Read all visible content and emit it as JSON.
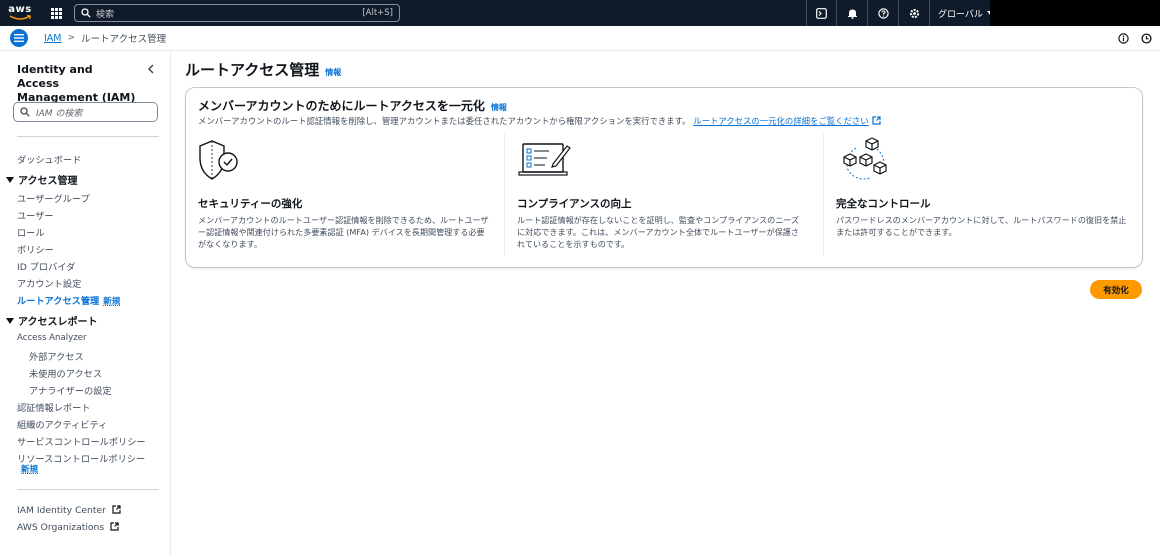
{
  "topbar": {
    "logo_text": "aws",
    "search_placeholder": "検索",
    "search_shortcut": "[Alt+S]",
    "region": "グローバル"
  },
  "breadcrumb": {
    "root": "IAM",
    "current": "ルートアクセス管理"
  },
  "sidebar": {
    "title": "Identity and Access Management (IAM)",
    "search_placeholder": "IAM の検索",
    "dashboard": "ダッシュボード",
    "access_mgmt_heading": "アクセス管理",
    "access_mgmt_items": [
      "ユーザーグループ",
      "ユーザー",
      "ロール",
      "ポリシー",
      "ID プロバイダ",
      "アカウント設定"
    ],
    "root_access": "ルートアクセス管理",
    "new_badge": "新規",
    "access_reports_heading": "アクセスレポート",
    "access_analyzer": "Access Analyzer",
    "analyzer_items": [
      "外部アクセス",
      "未使用のアクセス",
      "アナライザーの設定"
    ],
    "report_items": [
      "認証情報レポート",
      "組織のアクティビティ",
      "サービスコントロールポリシー"
    ],
    "resource_policy": "リソースコントロールポリシー",
    "resource_policy_badge": "新規",
    "external_links": [
      "IAM Identity Center",
      "AWS Organizations"
    ]
  },
  "main": {
    "title": "ルートアクセス管理",
    "info": "情報",
    "card": {
      "title": "メンバーアカウントのためにルートアクセスを一元化",
      "info": "情報",
      "description": "メンバーアカウントのルート認証情報を削除し、管理アカウントまたは委任されたアカウントから権限アクションを実行できます。",
      "link": "ルートアクセスの一元化の詳細をご覧ください",
      "columns": [
        {
          "title": "セキュリティーの強化",
          "desc": "メンバーアカウントのルートユーザー認証情報を削除できるため、ルートユーザー認証情報や関連付けられた多要素認証 (MFA) デバイスを長期間管理する必要がなくなります。"
        },
        {
          "title": "コンプライアンスの向上",
          "desc": "ルート認証情報が存在しないことを証明し、監査やコンプライアンスのニーズに対応できます。これは、メンバーアカウント全体でルートユーザーが保護されていることを示すものです。"
        },
        {
          "title": "完全なコントロール",
          "desc": "パスワードレスのメンバーアカウントに対して、ルートパスワードの復旧を禁止または許可することができます。"
        }
      ]
    },
    "enable_button": "有効化"
  },
  "colors": {
    "accent": "#0972d3",
    "primary_button": "#ff9900",
    "topbar": "#0f1b2a"
  }
}
